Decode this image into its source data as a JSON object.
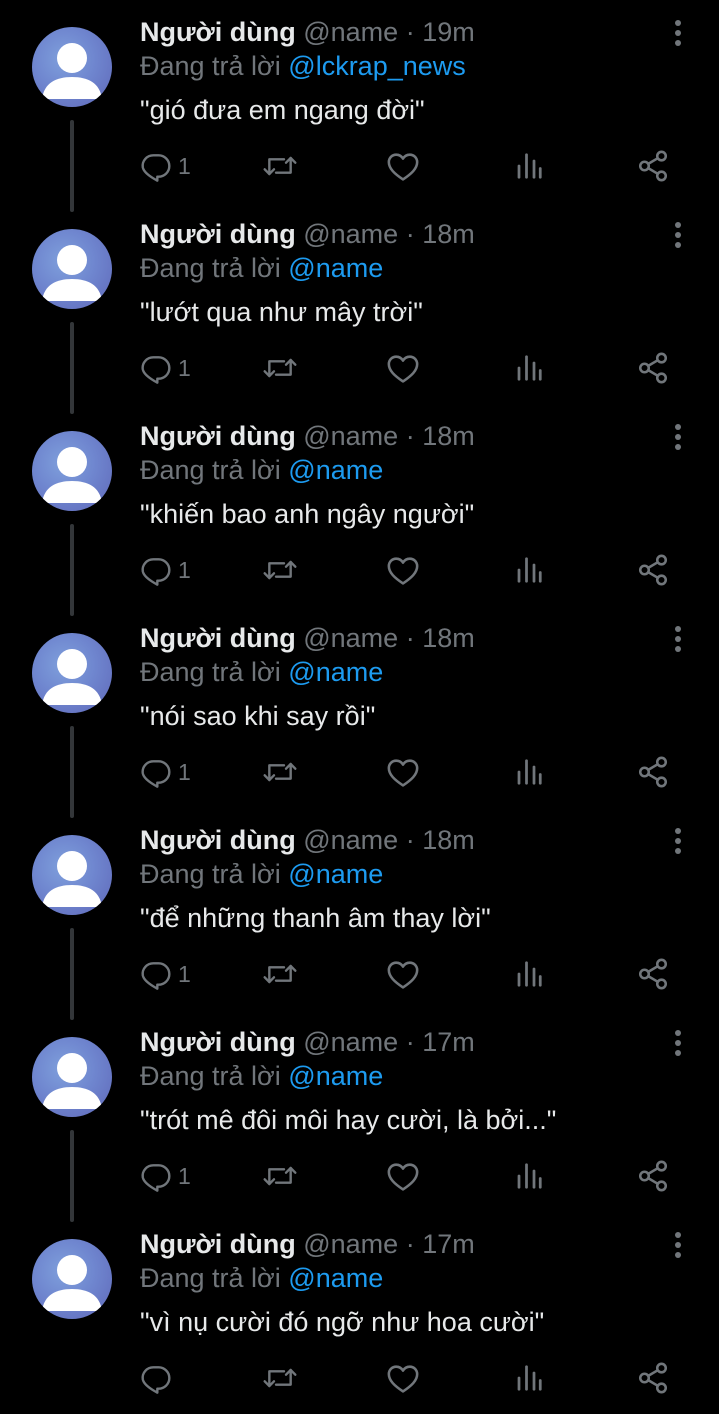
{
  "colors": {
    "background": "#000000",
    "primary_text": "#e7e9ea",
    "secondary_text": "#71767b",
    "accent": "#1d9bf0",
    "thread_line": "#333639"
  },
  "icons": [
    "more-vertical-icon",
    "reply-icon",
    "retweet-icon",
    "like-icon",
    "views-icon",
    "share-icon"
  ],
  "tweets": [
    {
      "name": "Người dùng",
      "handle": "@name",
      "dot": "·",
      "time": "19m",
      "replying_label": "Đang trả lời",
      "mention": "@lckrap_news",
      "text": "\"gió đưa em ngang đời\"",
      "reply_count": "1"
    },
    {
      "name": "Người dùng",
      "handle": "@name",
      "dot": "·",
      "time": "18m",
      "replying_label": "Đang trả lời",
      "mention": "@name",
      "text": "\"lướt qua như mây trời\"",
      "reply_count": "1"
    },
    {
      "name": "Người dùng",
      "handle": "@name",
      "dot": "·",
      "time": "18m",
      "replying_label": "Đang trả lời",
      "mention": "@name",
      "text": "\"khiến bao anh ngây người\"",
      "reply_count": "1"
    },
    {
      "name": "Người dùng",
      "handle": "@name",
      "dot": "·",
      "time": "18m",
      "replying_label": "Đang trả lời",
      "mention": "@name",
      "text": "\"nói sao khi say rồi\"",
      "reply_count": "1"
    },
    {
      "name": "Người dùng",
      "handle": "@name",
      "dot": "·",
      "time": "18m",
      "replying_label": "Đang trả lời",
      "mention": "@name",
      "text": "\"để những thanh âm thay lời\"",
      "reply_count": "1"
    },
    {
      "name": "Người dùng",
      "handle": "@name",
      "dot": "·",
      "time": "17m",
      "replying_label": "Đang trả lời",
      "mention": "@name",
      "text": "\"trót mê đôi môi hay cười, là bởi...\"",
      "reply_count": "1"
    },
    {
      "name": "Người dùng",
      "handle": "@name",
      "dot": "·",
      "time": "17m",
      "replying_label": "Đang trả lời",
      "mention": "@name",
      "text": "\"vì nụ cười đó ngỡ như hoa cười\"",
      "reply_count": ""
    }
  ]
}
